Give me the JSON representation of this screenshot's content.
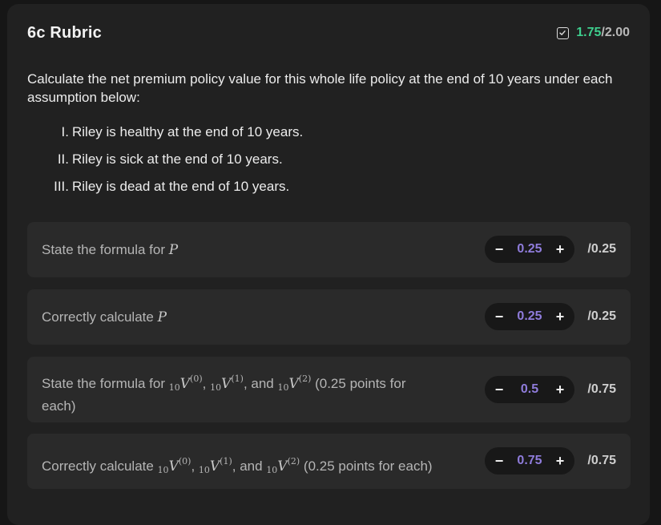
{
  "rubric": {
    "title": "6c Rubric",
    "score_earned": "1.75",
    "score_sep": "/",
    "score_total": "2.00",
    "score_color": "#3ecf8e"
  },
  "question": {
    "prompt": "Calculate the net premium policy value for this whole life policy at the end of 10 years under each assumption below:",
    "assumptions": [
      {
        "numeral": "I.",
        "text": "Riley is healthy at the end of 10 years."
      },
      {
        "numeral": "II.",
        "text": "Riley is sick at the end of 10 years."
      },
      {
        "numeral": "III.",
        "text": "Riley is dead at the end of 10 years."
      }
    ]
  },
  "criteria": [
    {
      "text_before": "State the formula for ",
      "symbol": "P",
      "value": "0.25",
      "max": "/0.25"
    },
    {
      "text_before": "Correctly calculate ",
      "symbol": "P",
      "value": "0.25",
      "max": "/0.25"
    },
    {
      "text_before": "State the formula for ",
      "subscript": "10",
      "symbol": "V",
      "sup0": "(0)",
      "sup1": "(1)",
      "sup2": "(2)",
      "sep1": ", ",
      "sep2": ", and ",
      "text_after": " (0.25 points for each)",
      "value": "0.5",
      "max": "/0.75"
    },
    {
      "text_before": "Correctly calculate ",
      "subscript": "10",
      "symbol": "V",
      "sup0": "(0)",
      "sup1": "(1)",
      "sup2": "(2)",
      "sep1": ", ",
      "sep2": ", and ",
      "text_after": " (0.25 points for each)",
      "value": "0.75",
      "max": "/0.75"
    }
  ],
  "controls": {
    "decrement_label": "−",
    "increment_label": "+"
  },
  "icons": {
    "score_icon": "checkbox-checked-icon"
  },
  "colors": {
    "earned_green": "#3ecf8e",
    "stepper_value_purple": "#8f7cdb",
    "card_bg": "#212121",
    "criterion_bg": "#2a2a2a"
  }
}
